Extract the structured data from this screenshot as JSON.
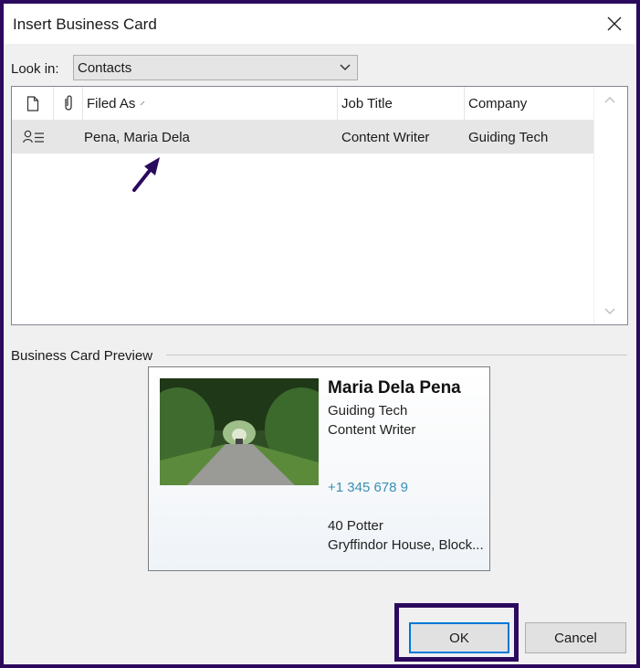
{
  "window": {
    "title": "Insert Business Card"
  },
  "look_in": {
    "label": "Look in:",
    "value": "Contacts"
  },
  "list": {
    "columns": {
      "filed_as": "Filed As",
      "job_title": "Job Title",
      "company": "Company"
    },
    "rows": [
      {
        "filed_as": "Pena, Maria Dela",
        "job_title": "Content Writer",
        "company": "Guiding Tech"
      }
    ]
  },
  "preview": {
    "label": "Business Card Preview",
    "card": {
      "name": "Maria Dela Pena",
      "company": "Guiding Tech",
      "job_title": "Content Writer",
      "phone": "+1 345 678 9",
      "address_line1": "40 Potter",
      "address_line2": "Gryffindor House, Block..."
    }
  },
  "buttons": {
    "ok": "OK",
    "cancel": "Cancel"
  },
  "colors": {
    "annotation": "#2b0a5e",
    "accent": "#0078d7",
    "phone": "#3a8fb5"
  }
}
